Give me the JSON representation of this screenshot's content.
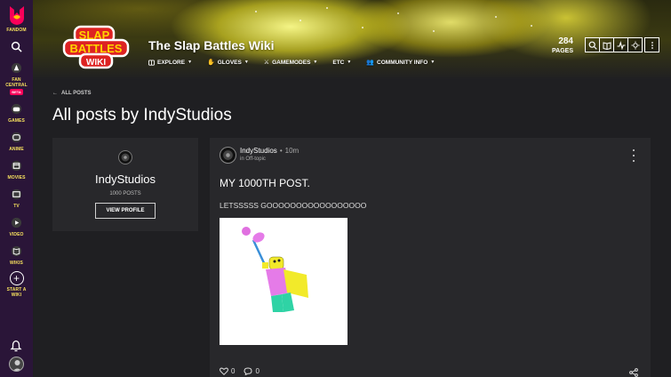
{
  "global_nav": {
    "fandom_label": "FANDOM",
    "fan_central_label": "FAN\nCENTRAL",
    "beta_badge": "BETA",
    "games_label": "GAMES",
    "anime_label": "ANIME",
    "movies_label": "MOVIES",
    "tv_label": "TV",
    "video_label": "VIDEO",
    "wikis_label": "WIKIS",
    "start_wiki_label": "START A\nWIKI"
  },
  "header": {
    "wiki_title": "The Slap Battles Wiki",
    "logo_line1": "SLAP",
    "logo_line2": "BATTLES",
    "logo_line3": "WIKI",
    "nav": {
      "explore": "EXPLORE",
      "gloves": "GLOVES",
      "gamemodes": "GAMEMODES",
      "etc": "ETC",
      "community": "COMMUNITY INFO"
    },
    "pages_count": "284",
    "pages_label": "PAGES"
  },
  "content": {
    "back_link": "ALL POSTS",
    "page_title": "All posts by IndyStudios"
  },
  "profile": {
    "username": "IndyStudios",
    "post_count": "1000 POSTS",
    "view_profile": "VIEW PROFILE"
  },
  "post": {
    "author": "IndyStudios",
    "time": "10m",
    "category": "in Off-topic",
    "title": "MY 1000TH POST.",
    "body": "LETSSSSS GOOOOOOOOOOOOOOOOO",
    "likes": "0",
    "comments": "0"
  },
  "colors": {
    "nav_bg": "#2a1538",
    "nav_label": "#f6e05e",
    "page_bg": "#1f1f22",
    "card_bg": "#28282b",
    "banner_yellow": "#f0e628"
  }
}
